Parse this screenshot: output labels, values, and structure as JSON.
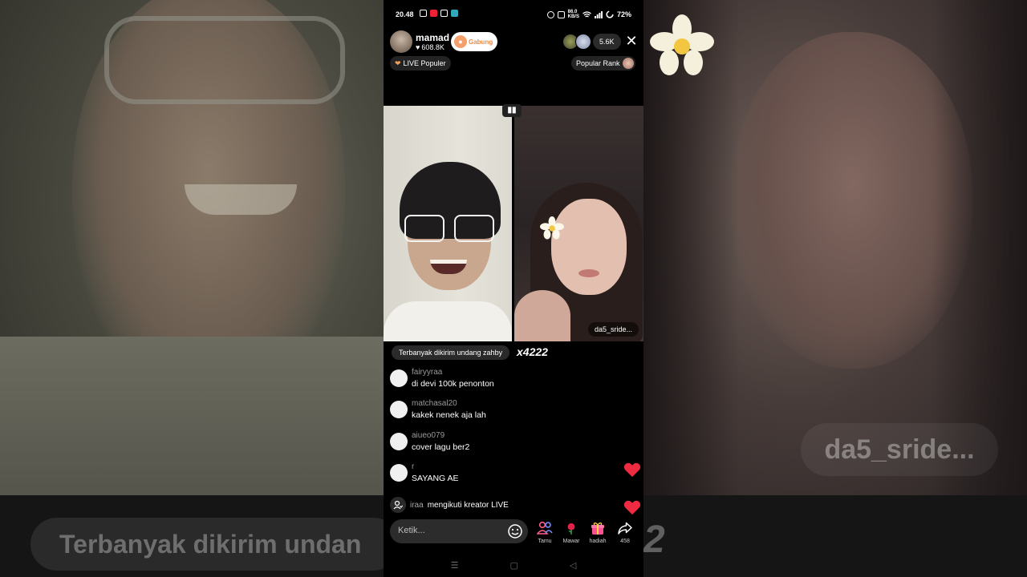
{
  "status_bar": {
    "time": "20.48",
    "network_speed": "86.0",
    "network_unit": "KB/S",
    "battery": "72%"
  },
  "host": {
    "name": "mamad",
    "likes": "608.8K",
    "join_label": "Gabung"
  },
  "viewers": {
    "count": "5.6K"
  },
  "chips": {
    "live_popular": "LIVE Populer",
    "popular_rank": "Popular Rank"
  },
  "battle": {
    "guest_name": "da5_sride..."
  },
  "gift_banner": {
    "text": "Terbanyak dikirim undang zahby",
    "combo": "x4222"
  },
  "comments": [
    {
      "user": "fairyyraa",
      "text": "di devi 100k penonton"
    },
    {
      "user": "matchasal20",
      "text": "kakek nenek aja lah"
    },
    {
      "user": "aiueo079",
      "text": "cover lagu ber2"
    },
    {
      "user": "r",
      "text": "SAYANG AE"
    }
  ],
  "follow_event": {
    "user": "iraa",
    "text": "mengikuti kreator LIVE"
  },
  "input": {
    "placeholder": "Ketik..."
  },
  "actions": [
    {
      "label": "Tamu",
      "icon": "guests-icon"
    },
    {
      "label": "Mawar",
      "icon": "rose-icon"
    },
    {
      "label": "hadiah",
      "icon": "gift-icon"
    },
    {
      "label": "458",
      "icon": "share-icon"
    }
  ],
  "background": {
    "left_caption": "Terbanyak dikirim undan",
    "left_digit": "2",
    "right_caption": "da5_sride..."
  },
  "colors": {
    "accent_orange": "#f08a42",
    "heart_red": "#ee2b40",
    "pink_actions": "#ff5c8a"
  }
}
